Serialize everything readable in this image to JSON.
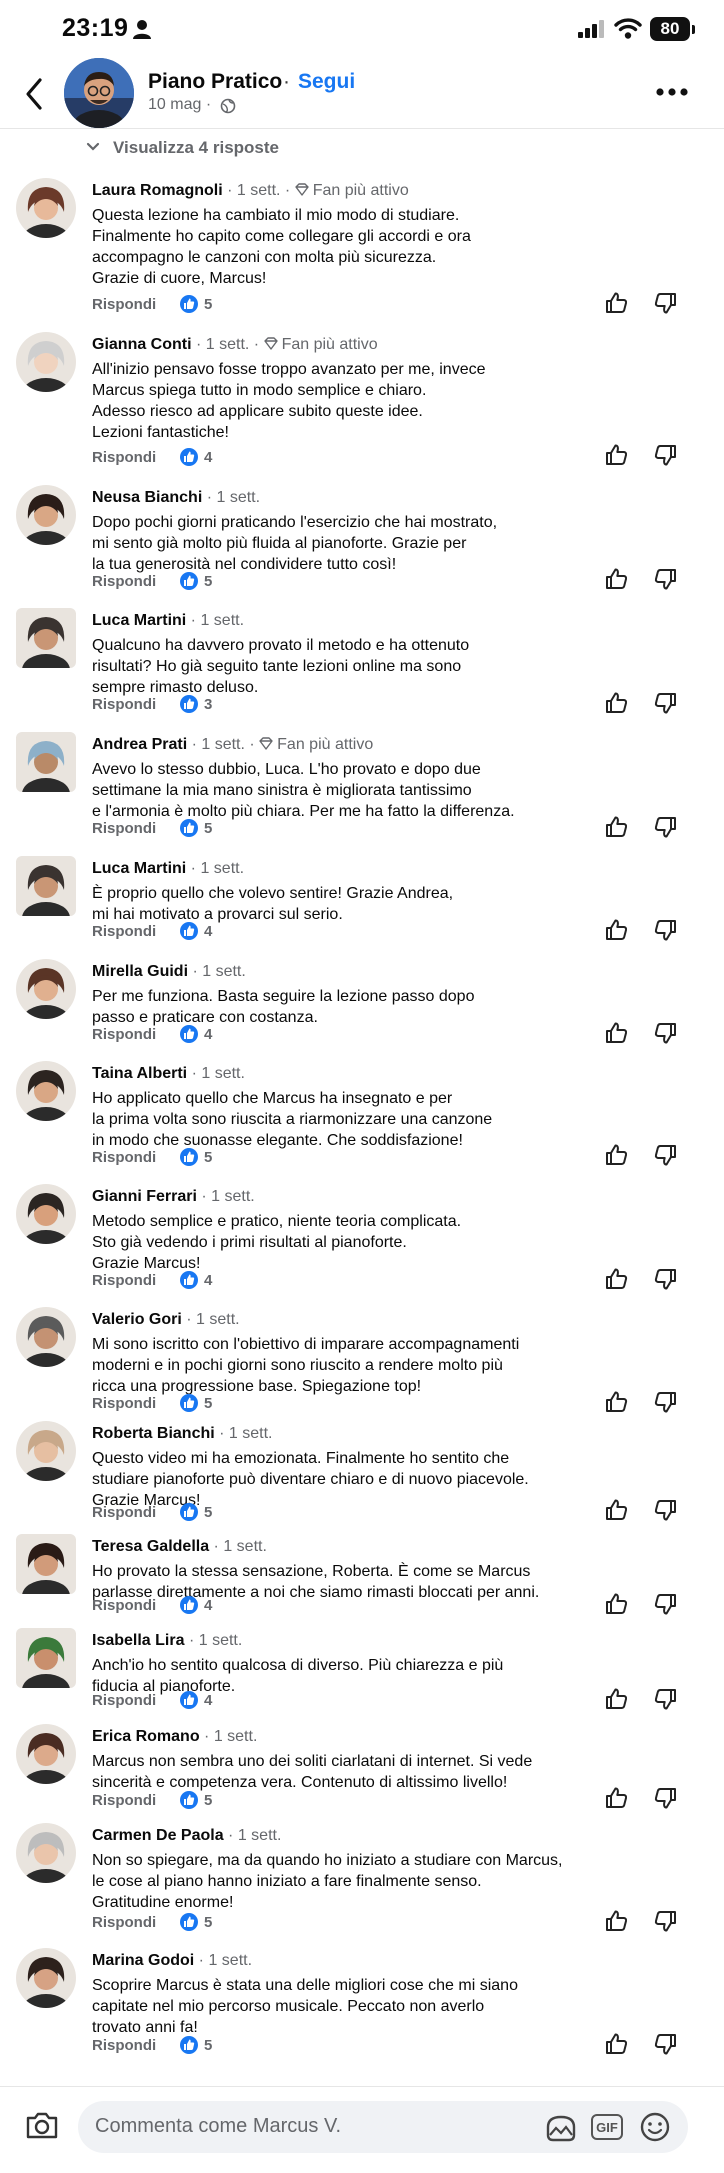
{
  "status_bar": {
    "time": "23:19",
    "battery": "80"
  },
  "header": {
    "name": "Piano Pratico",
    "separator": "·",
    "follow": "Segui",
    "date": "10 mag ·"
  },
  "view_replies": "Visualizza 4 risposte",
  "reply_label": "Rispondi",
  "fan_label": "Fan più attivo",
  "comments": [
    {
      "name": "Laura Romagnoli",
      "time": "1 sett.",
      "fan": true,
      "text": "Questa lezione ha cambiato il mio modo di studiare.\nFinalmente ho capito come collegare gli accordi e ora\naccompagno le canzoni con molta più sicurezza.\nGrazie di cuore, Marcus!",
      "likes": "5"
    },
    {
      "name": "Gianna Conti",
      "time": "1 sett.",
      "fan": true,
      "text": "All'inizio pensavo fosse troppo avanzato per me, invece\nMarcus spiega tutto in modo semplice e chiaro.\nAdesso riesco ad applicare subito queste idee.\nLezioni fantastiche!",
      "likes": "4"
    },
    {
      "name": "Neusa Bianchi",
      "time": "1 sett.",
      "fan": false,
      "text": "Dopo pochi giorni praticando l'esercizio che hai mostrato,\nmi sento già molto più fluida al pianoforte. Grazie per\nla tua generosità nel condividere tutto così!",
      "likes": "5"
    },
    {
      "name": "Luca Martini",
      "time": "1 sett.",
      "fan": false,
      "text": "Qualcuno ha davvero provato il metodo e ha ottenuto\nrisultati? Ho già seguito tante lezioni online ma sono\nsempre rimasto deluso.",
      "likes": "3"
    },
    {
      "name": "Andrea Prati",
      "time": "1 sett.",
      "fan": true,
      "text": "Avevo lo stesso dubbio, Luca. L'ho provato e dopo due\nsettimane la mia mano sinistra è migliorata tantissimo\ne l'armonia è molto più chiara. Per me ha fatto la differenza.",
      "likes": "5"
    },
    {
      "name": "Luca Martini",
      "time": "1 sett.",
      "fan": false,
      "text": "È proprio quello che volevo sentire! Grazie Andrea,\nmi hai motivato a provarci sul serio.",
      "likes": "4"
    },
    {
      "name": "Mirella Guidi",
      "time": "1 sett.",
      "fan": false,
      "text": "Per me funziona. Basta seguire la lezione passo dopo\npasso e praticare con costanza.",
      "likes": "4"
    },
    {
      "name": "Taina Alberti",
      "time": "1 sett.",
      "fan": false,
      "text": "Ho applicato quello che Marcus ha insegnato e per\nla prima volta sono riuscita a riarmonizzare una canzone\nin modo che suonasse elegante. Che soddisfazione!",
      "likes": "5"
    },
    {
      "name": "Gianni Ferrari",
      "time": "1 sett.",
      "fan": false,
      "text": "Metodo semplice e pratico, niente teoria complicata.\nSto già vedendo i primi risultati al pianoforte.\nGrazie Marcus!",
      "likes": "4"
    },
    {
      "name": "Valerio Gori",
      "time": "1 sett.",
      "fan": false,
      "text": "Mi sono iscritto con l'obiettivo di imparare accompagnamenti\nmoderni e in pochi giorni sono riuscito a rendere molto più\nricca una progressione base. Spiegazione top!",
      "likes": "5"
    },
    {
      "name": "Roberta Bianchi",
      "time": "1 sett.",
      "fan": false,
      "text": "Questo video mi ha emozionata. Finalmente ho sentito che\nstudiare pianoforte può diventare chiaro e di nuovo piacevole.\nGrazie Marcus!",
      "likes": "5"
    },
    {
      "name": "Teresa Galdella",
      "time": "1 sett.",
      "fan": false,
      "text": "Ho provato la stessa sensazione, Roberta. È come se Marcus\nparlasse direttamente a noi che siamo rimasti bloccati per anni.",
      "likes": "4"
    },
    {
      "name": "Isabella Lira",
      "time": "1 sett.",
      "fan": false,
      "text": "Anch'io ho sentito qualcosa di diverso. Più chiarezza e più\nfiducia al pianoforte.",
      "likes": "4"
    },
    {
      "name": "Erica Romano",
      "time": "1 sett.",
      "fan": false,
      "text": "Marcus non sembra uno dei soliti ciarlatani di internet. Si vede\nsincerità e competenza vera. Contenuto di altissimo livello!",
      "likes": "5"
    },
    {
      "name": "Carmen De Paola",
      "time": "1 sett.",
      "fan": false,
      "text": "Non so spiegare, ma da quando ho iniziato a studiare con Marcus,\nle cose al piano hanno iniziato a fare finalmente senso.\nGratitudine enorme!",
      "likes": "5"
    },
    {
      "name": "Marina Godoi",
      "time": "1 sett.",
      "fan": false,
      "text": "Scoprire Marcus è stata una delle migliori cose che mi siano\ncapitate nel mio percorso musicale. Peccato non averlo\ntrovato anni fa!",
      "likes": "5"
    }
  ],
  "composer": {
    "placeholder": "Commenta come Marcus V.",
    "gif": "GIF"
  },
  "colors": {
    "accent": "#1877f2",
    "secondary_text": "#65676b",
    "composer_bg": "#f0f2f5"
  }
}
